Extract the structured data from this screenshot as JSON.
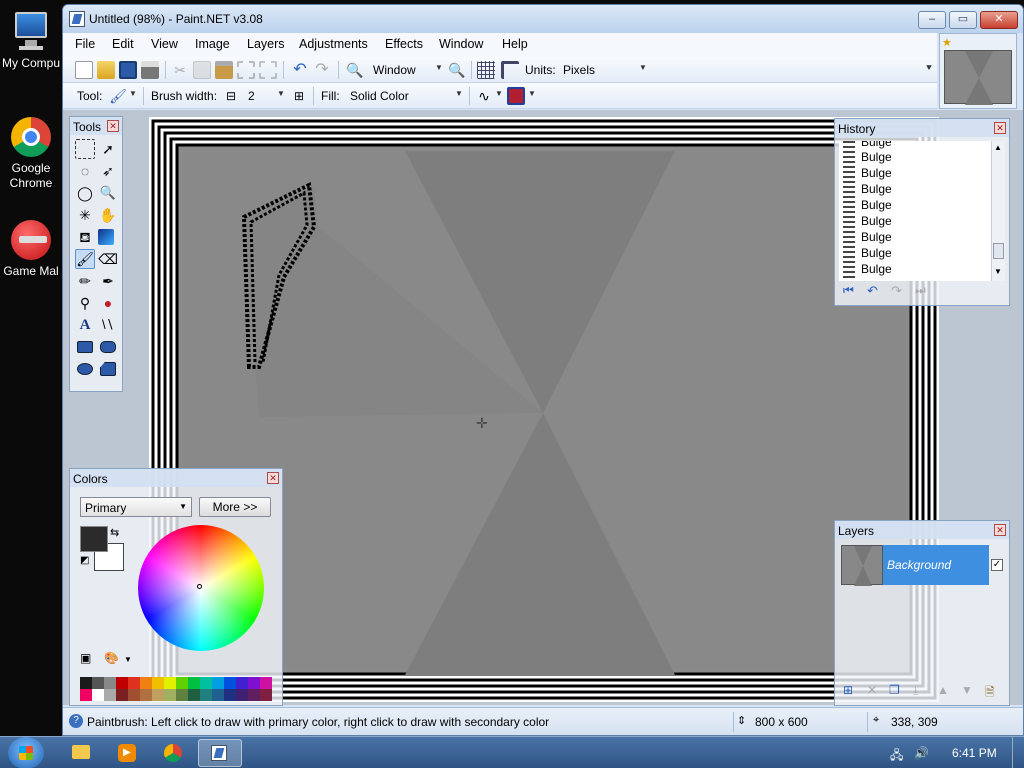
{
  "desktop": {
    "icons": [
      {
        "label": "My Compu"
      },
      {
        "label": "Google Chrome"
      },
      {
        "label": "Game Mal"
      }
    ]
  },
  "window": {
    "title": "Untitled (98%) - Paint.NET v3.08",
    "buttons": {
      "minimize": "–",
      "maximize": "▭",
      "close": "✕"
    }
  },
  "menu": [
    "File",
    "Edit",
    "View",
    "Image",
    "Layers",
    "Adjustments",
    "Effects",
    "Window",
    "Help"
  ],
  "toolbar1": {
    "zoom_value": "Window",
    "units_label": "Units:",
    "units_value": "Pixels"
  },
  "toolbar2": {
    "tool_label": "Tool:",
    "brush_width_label": "Brush width:",
    "brush_width_minus": "⊟",
    "brush_width_value": "2",
    "brush_width_plus": "⊞",
    "fill_label": "Fill:",
    "fill_value": "Solid Color"
  },
  "panels": {
    "tools_title": "Tools",
    "colors_title": "Colors",
    "colors_mode": "Primary",
    "colors_more": "More >>",
    "history_title": "History",
    "history_items": [
      "Bulge",
      "Bulge",
      "Bulge",
      "Bulge",
      "Bulge",
      "Bulge",
      "Bulge",
      "Bulge",
      "Bulge"
    ],
    "layers_title": "Layers",
    "layer_name": "Background"
  },
  "status": {
    "hint": "Paintbrush: Left click to draw with primary color, right click to draw with secondary color",
    "image_size": "800 x 600",
    "cursor_pos": "338, 309"
  },
  "taskbar": {
    "clock": "6:41 PM"
  },
  "colors": {
    "title_bg": "#cfdff2",
    "accent": "#3f8fe0",
    "primary_color": "#2b2b2b",
    "secondary_color": "#ffffff"
  },
  "palette": [
    "#1a1a1a",
    "#555555",
    "#888888",
    "#c00000",
    "#e03020",
    "#f08010",
    "#f0c000",
    "#e0f000",
    "#60d000",
    "#00c040",
    "#00c0a0",
    "#00a0e0",
    "#0050e0",
    "#4020d0",
    "#8010d0",
    "#d010a0",
    "#f00060",
    "#ffffff",
    "#aaaaaa",
    "#7a2020",
    "#a05030",
    "#b07040",
    "#c0a060",
    "#a0b060",
    "#608040",
    "#206040",
    "#208080",
    "#206090",
    "#203080",
    "#402070",
    "#602060",
    "#802040"
  ]
}
